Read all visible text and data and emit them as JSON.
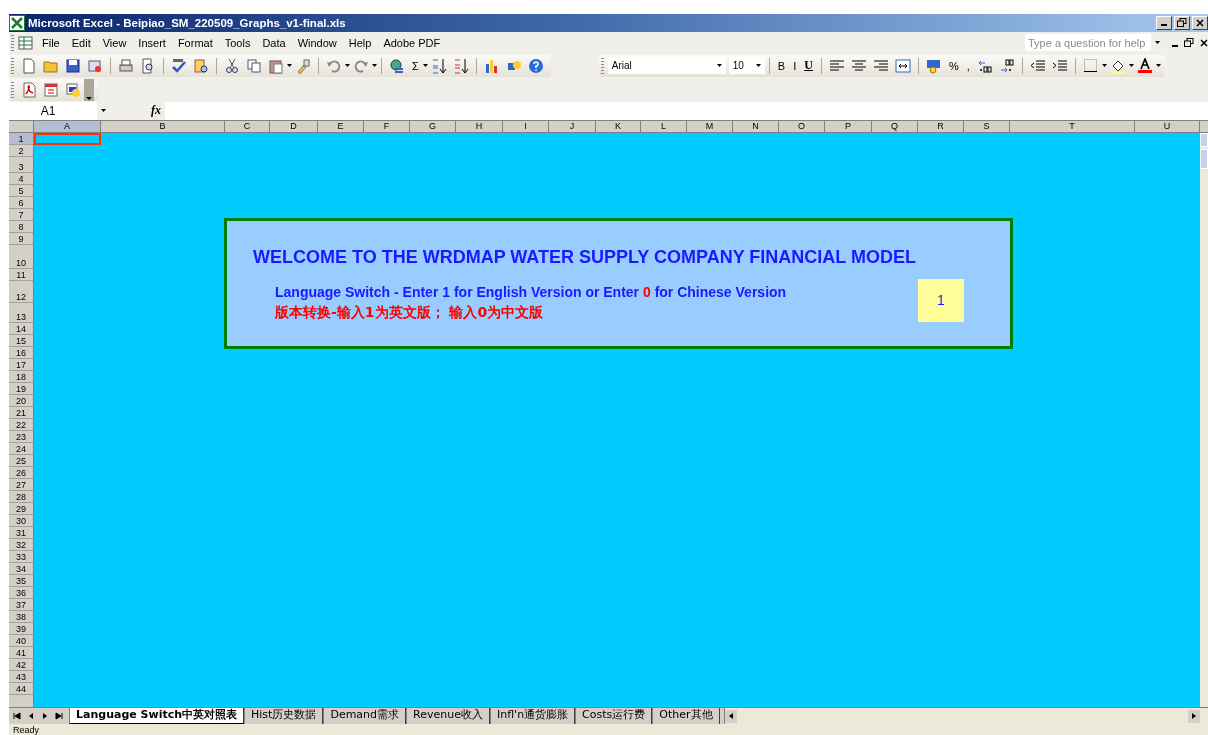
{
  "window": {
    "title": "Microsoft Excel - Beipiao_SM_220509_Graphs_v1-final.xls"
  },
  "menu": [
    {
      "label": "File"
    },
    {
      "label": "Edit"
    },
    {
      "label": "View"
    },
    {
      "label": "Insert"
    },
    {
      "label": "Format"
    },
    {
      "label": "Tools"
    },
    {
      "label": "Data"
    },
    {
      "label": "Window"
    },
    {
      "label": "Help"
    },
    {
      "label": "Adobe PDF"
    }
  ],
  "help_search": {
    "placeholder": "Type a question for help"
  },
  "standard_toolbar": {
    "sum": "Σ"
  },
  "formatting_toolbar": {
    "font": "Arial",
    "size": "10",
    "bold": "B",
    "italic": "I",
    "underline": "U",
    "percent": "%",
    "comma": ","
  },
  "formula_bar": {
    "name_box": "A1",
    "fx": "fx"
  },
  "columns": [
    {
      "label": "A",
      "selected": true
    },
    {
      "label": "B",
      "selected": false
    },
    {
      "label": "C",
      "selected": false
    },
    {
      "label": "D",
      "selected": false
    },
    {
      "label": "E",
      "selected": false
    },
    {
      "label": "F",
      "selected": false
    },
    {
      "label": "G",
      "selected": false
    },
    {
      "label": "H",
      "selected": false
    },
    {
      "label": "I",
      "selected": false
    },
    {
      "label": "J",
      "selected": false
    },
    {
      "label": "K",
      "selected": false
    },
    {
      "label": "L",
      "selected": false
    },
    {
      "label": "M",
      "selected": false
    },
    {
      "label": "N",
      "selected": false
    },
    {
      "label": "O",
      "selected": false
    },
    {
      "label": "P",
      "selected": false
    },
    {
      "label": "Q",
      "selected": false
    },
    {
      "label": "R",
      "selected": false
    },
    {
      "label": "S",
      "selected": false
    },
    {
      "label": "T",
      "selected": false
    },
    {
      "label": "U",
      "selected": false
    }
  ],
  "rows": [
    {
      "label": "1",
      "selected": true
    },
    {
      "label": "2",
      "selected": false
    },
    {
      "label": "3",
      "selected": false
    },
    {
      "label": "4",
      "selected": false
    },
    {
      "label": "5",
      "selected": false
    },
    {
      "label": "6",
      "selected": false
    },
    {
      "label": "7",
      "selected": false
    },
    {
      "label": "8",
      "selected": false
    },
    {
      "label": "9",
      "selected": false
    },
    {
      "label": "10",
      "selected": false
    },
    {
      "label": "11",
      "selected": false
    },
    {
      "label": "12",
      "selected": false
    },
    {
      "label": "13",
      "selected": false
    },
    {
      "label": "14",
      "selected": false
    },
    {
      "label": "15",
      "selected": false
    },
    {
      "label": "16",
      "selected": false
    },
    {
      "label": "17",
      "selected": false
    },
    {
      "label": "18",
      "selected": false
    },
    {
      "label": "19",
      "selected": false
    },
    {
      "label": "20",
      "selected": false
    },
    {
      "label": "21",
      "selected": false
    },
    {
      "label": "22",
      "selected": false
    },
    {
      "label": "23",
      "selected": false
    },
    {
      "label": "24",
      "selected": false
    },
    {
      "label": "25",
      "selected": false
    },
    {
      "label": "26",
      "selected": false
    },
    {
      "label": "27",
      "selected": false
    },
    {
      "label": "28",
      "selected": false
    },
    {
      "label": "29",
      "selected": false
    },
    {
      "label": "30",
      "selected": false
    },
    {
      "label": "31",
      "selected": false
    },
    {
      "label": "32",
      "selected": false
    },
    {
      "label": "33",
      "selected": false
    },
    {
      "label": "34",
      "selected": false
    },
    {
      "label": "35",
      "selected": false
    },
    {
      "label": "36",
      "selected": false
    },
    {
      "label": "37",
      "selected": false
    },
    {
      "label": "38",
      "selected": false
    },
    {
      "label": "39",
      "selected": false
    },
    {
      "label": "40",
      "selected": false
    },
    {
      "label": "41",
      "selected": false
    },
    {
      "label": "42",
      "selected": false
    },
    {
      "label": "43",
      "selected": false
    },
    {
      "label": "44",
      "selected": false
    }
  ],
  "panel": {
    "title": "WELCOME TO THE WRDMAP WATER SUPPLY COMPANY FINANCIAL MODEL",
    "line_en": [
      {
        "text": "Language Switch - Enter 1 for English Version or Enter ",
        "color": "#1a1aff"
      },
      {
        "text": "0",
        "color": "#ff0000"
      },
      {
        "text": " for Chinese Version",
        "color": "#1a1aff"
      }
    ],
    "line_cn": "版本转换-输入1为英文版； 输入0为中文版",
    "input_value": "1"
  },
  "sheet_tabs": [
    {
      "label": "Language Switch中英对照表",
      "selected": true
    },
    {
      "label": "Hist历史数据",
      "selected": false
    },
    {
      "label": "Demand需求",
      "selected": false
    },
    {
      "label": "Revenue收入",
      "selected": false
    },
    {
      "label": "Infl'n通货膨胀",
      "selected": false
    },
    {
      "label": "Costs运行费",
      "selected": false
    },
    {
      "label": "Other其他",
      "selected": false
    }
  ],
  "status_bar": {
    "text": "Ready"
  }
}
